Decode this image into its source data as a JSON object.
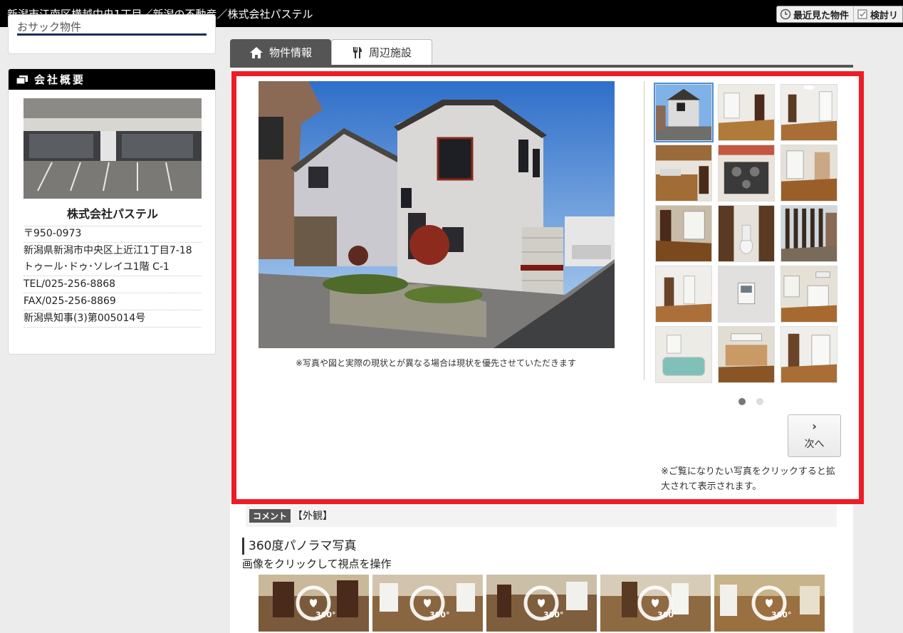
{
  "page": {
    "title": "新潟市江南区横越中央1丁目／新潟の不動産／株式会社パステル",
    "tools": [
      {
        "icon": "clock-icon",
        "label": "最近見た物件"
      },
      {
        "icon": "checkbox-icon",
        "label": "検討リ"
      }
    ]
  },
  "sidebar": {
    "recent_label": "おサック物件",
    "company": {
      "heading": "会社概要",
      "name": "株式会社パステル",
      "postal": "〒950-0973",
      "address": "新潟県新潟市中央区上近江1丁目7-18トゥール･ドゥ･ソレイユ1階 C-1",
      "tel": "TEL/025-256-8868",
      "fax": "FAX/025-256-8869",
      "license": "新潟県知事(3)第005014号"
    }
  },
  "tabs": [
    {
      "icon": "home-icon",
      "label": "物件情報",
      "active": true
    },
    {
      "icon": "fork-knife-icon",
      "label": "周辺施設",
      "active": false
    }
  ],
  "gallery": {
    "caption": "※写真や図と実際の現状とが異なる場合は現状を優先させていただきます",
    "thumbnail_count": 15,
    "page_dots": 2,
    "current_page": 1,
    "next_label": "次へ",
    "note": "※ご覧になりたい写真をクリックすると拡大されて表示されます。"
  },
  "comment": {
    "badge": "コメント",
    "text": "【外観】"
  },
  "panorama": {
    "title": "360度パノラマ写真",
    "subtitle": "画像をクリックして視点を操作",
    "badge_text": "360°",
    "count": 5
  },
  "colors": {
    "highlight_border": "#ee1c25",
    "active_tab": "#555555",
    "header_bar": "#000000"
  }
}
